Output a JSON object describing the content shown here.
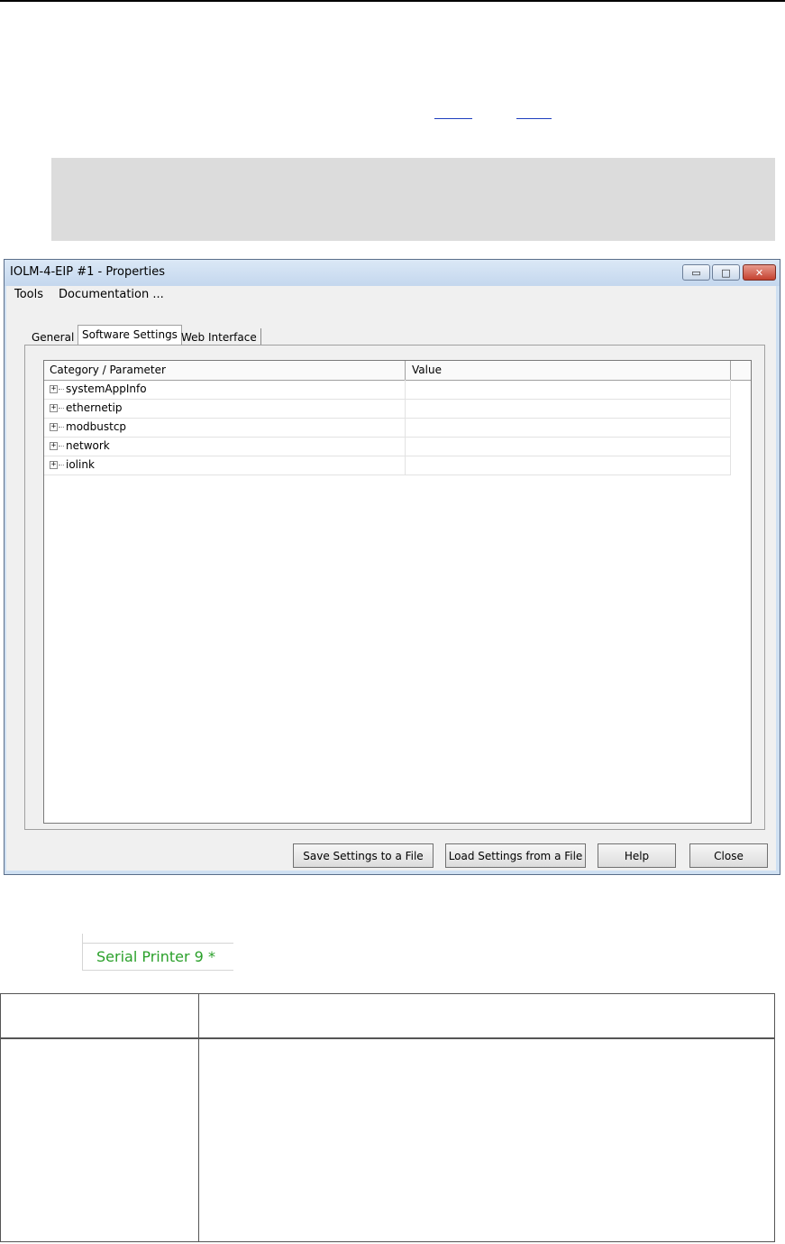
{
  "window": {
    "title": "IOLM-4-EIP #1 - Properties",
    "menu": [
      "Tools",
      "Documentation ..."
    ],
    "tabs": [
      "General",
      "Software Settings",
      "Web Interface"
    ],
    "active_tab": "Software Settings",
    "grid": {
      "columns": [
        "Category / Parameter",
        "Value"
      ],
      "rows": [
        "systemAppInfo",
        "ethernetip",
        "modbustcp",
        "network",
        "iolink"
      ]
    },
    "buttons": {
      "save": "Save Settings to a File",
      "load": "Load Settings from a File",
      "help": "Help",
      "close": "Close"
    },
    "caption_icons": [
      "minimize-icon",
      "maximize-icon",
      "close-icon"
    ]
  },
  "serial_tab": {
    "label": "Serial Printer 9 *",
    "color": "#2aa02a"
  }
}
